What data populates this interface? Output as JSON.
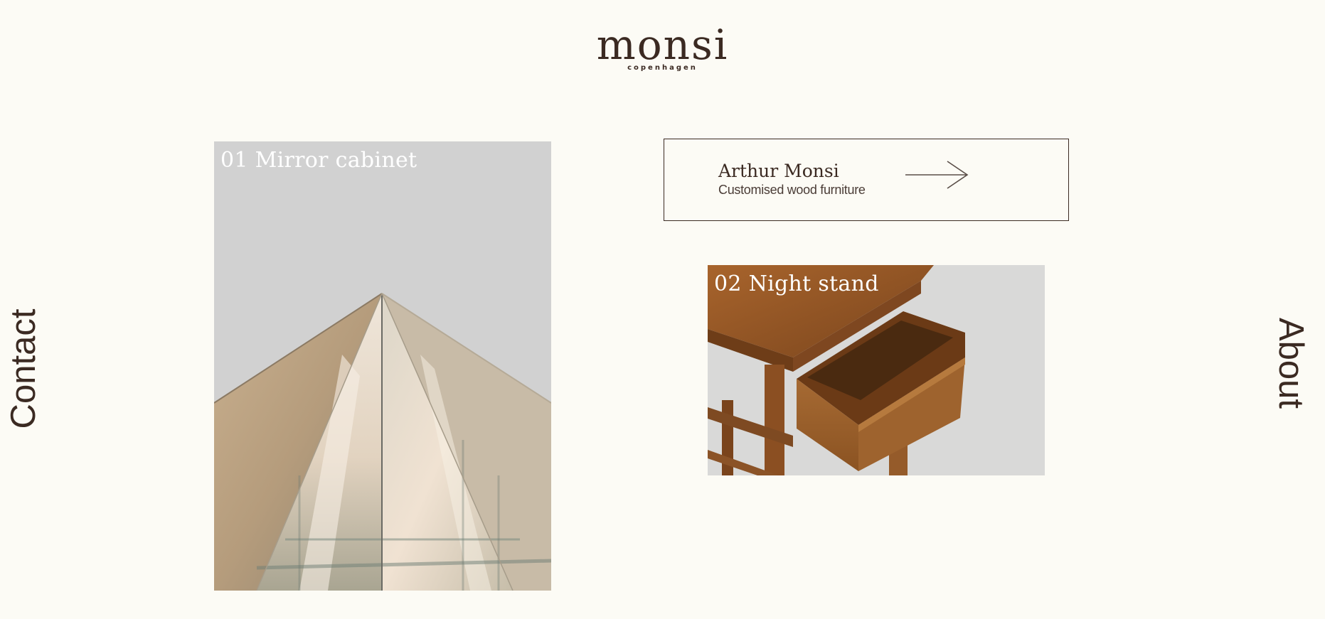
{
  "brand": {
    "name": "monsi",
    "tagline": "copenhagen"
  },
  "nav": {
    "contact": "Contact",
    "about": "About"
  },
  "info": {
    "name": "Arthur Monsi",
    "subtitle": "Customised wood furniture",
    "arrow_icon": "arrow-right-icon"
  },
  "projects": [
    {
      "title": "01 Mirror cabinet",
      "image": "mirror-pyramid-image"
    },
    {
      "title": "02 Night stand",
      "image": "wooden-night-stand-image"
    }
  ],
  "colors": {
    "background": "#fcfbf5",
    "text": "#3b2a22",
    "card_bg": "#d1d1d1",
    "card_title": "#ffffff"
  }
}
